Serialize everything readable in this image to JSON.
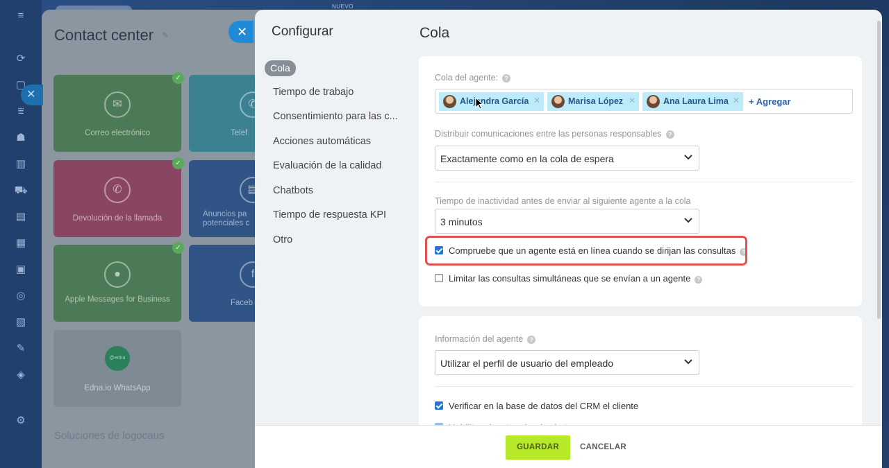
{
  "background": {
    "nuevo_badge": "NUEVO",
    "contact_center_title": "Contact center",
    "tiles": [
      {
        "label": "Correo electrónico",
        "icon": "mail-icon",
        "checked": true
      },
      {
        "label": "Telef",
        "icon": "phone-icon",
        "checked": false
      },
      {
        "label": "Devolución de la llamada",
        "icon": "callback-icon",
        "checked": true
      },
      {
        "label": "Anuncios pa potenciales c",
        "icon": "ads-icon",
        "checked": false
      },
      {
        "label": "Apple Messages for Business",
        "icon": "chat-bubble-icon",
        "checked": true
      },
      {
        "label": "Faceb",
        "icon": "facebook-icon",
        "checked": false
      },
      {
        "label": "Edna.io WhatsApp",
        "icon": "edna-icon",
        "checked": false
      }
    ],
    "edna_logo_text": "@edna",
    "soluciones_text": "Soluciones de logocaus"
  },
  "settings_menu": {
    "title": "Configurar",
    "items": [
      {
        "label": "Cola",
        "active": true
      },
      {
        "label": "Tiempo de trabajo",
        "active": false
      },
      {
        "label": "Consentimiento para las c...",
        "active": false
      },
      {
        "label": "Acciones automáticas",
        "active": false
      },
      {
        "label": "Evaluación de la calidad",
        "active": false
      },
      {
        "label": "Chatbots",
        "active": false
      },
      {
        "label": "Tiempo de respuesta KPI",
        "active": false
      },
      {
        "label": "Otro",
        "active": false
      }
    ]
  },
  "main": {
    "title": "Cola",
    "queue_card": {
      "agent_queue_label": "Cola del agente:",
      "agents": [
        {
          "name": "Alejandra García"
        },
        {
          "name": "Marisa López"
        },
        {
          "name": "Ana Laura Lima"
        }
      ],
      "add_label": "+ Agregar",
      "distribute_label": "Distribuir comunicaciones entre las personas responsables",
      "distribute_value": "Exactamente como en la cola de espera",
      "inactivity_label": "Tiempo de inactividad antes de enviar al siguiente agente a la cola",
      "inactivity_value": "3 minutos",
      "check_online_label": "Compruebe que un agente está en línea cuando se dirijan las consultas",
      "check_online_checked": true,
      "limit_label": "Limitar las consultas simultáneas que se envían a un agente",
      "limit_checked": false
    },
    "agent_info_card": {
      "agent_info_label": "Información del agente",
      "agent_info_value": "Utilizar el perfil de usuario del empleado",
      "verify_crm_label": "Verificar en la base de datos del CRM el cliente",
      "verify_crm_checked": true,
      "next_option_label": "Habilitar el rastreador de chat",
      "next_option_checked": true
    }
  },
  "footer": {
    "save_label": "GUARDAR",
    "cancel_label": "CANCELAR"
  },
  "colors": {
    "accent_blue": "#2475d6",
    "save_green": "#b6ea28",
    "highlight_red": "#e0524f",
    "chip_bg": "#bcebfa"
  }
}
